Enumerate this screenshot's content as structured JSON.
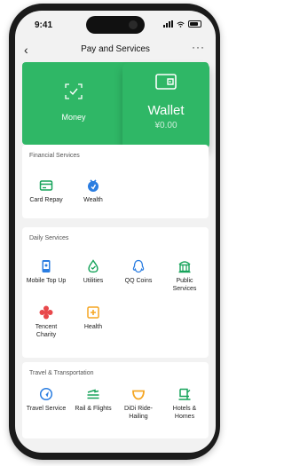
{
  "status": {
    "time": "9:41"
  },
  "nav": {
    "back": "‹",
    "title": "Pay and Services",
    "more": "···"
  },
  "header": {
    "money_label": "Money",
    "wallet_label": "Wallet",
    "wallet_amount": "¥0.00",
    "accent": "#2fb766"
  },
  "financial": {
    "title": "Financial Services",
    "items": [
      {
        "label": "Card Repay",
        "icon": "card-icon",
        "color": "#16a35a"
      },
      {
        "label": "Wealth",
        "icon": "wealth-icon",
        "color": "#2a7de1"
      }
    ]
  },
  "daily": {
    "title": "Daily Services",
    "items": [
      {
        "label": "Mobile Top Up",
        "icon": "mobile-icon",
        "color": "#2a7de1"
      },
      {
        "label": "Utilities",
        "icon": "utilities-icon",
        "color": "#16a35a"
      },
      {
        "label": "QQ Coins",
        "icon": "qq-icon",
        "color": "#2a7de1"
      },
      {
        "label": "Public Services",
        "icon": "public-services-icon",
        "color": "#16a35a"
      },
      {
        "label": "Tencent Charity",
        "icon": "charity-icon",
        "color": "#e8484b"
      },
      {
        "label": "Health",
        "icon": "health-icon",
        "color": "#f5a623"
      }
    ]
  },
  "travel": {
    "title": "Travel & Transportation",
    "items": [
      {
        "label": "Travel Service",
        "icon": "travel-icon",
        "color": "#2a7de1"
      },
      {
        "label": "Rail & Flights",
        "icon": "rail-icon",
        "color": "#16a35a"
      },
      {
        "label": "DiDi Ride-Hailing",
        "icon": "didi-icon",
        "color": "#f5a623"
      },
      {
        "label": "Hotels & Homes",
        "icon": "hotel-icon",
        "color": "#16a35a"
      }
    ]
  }
}
